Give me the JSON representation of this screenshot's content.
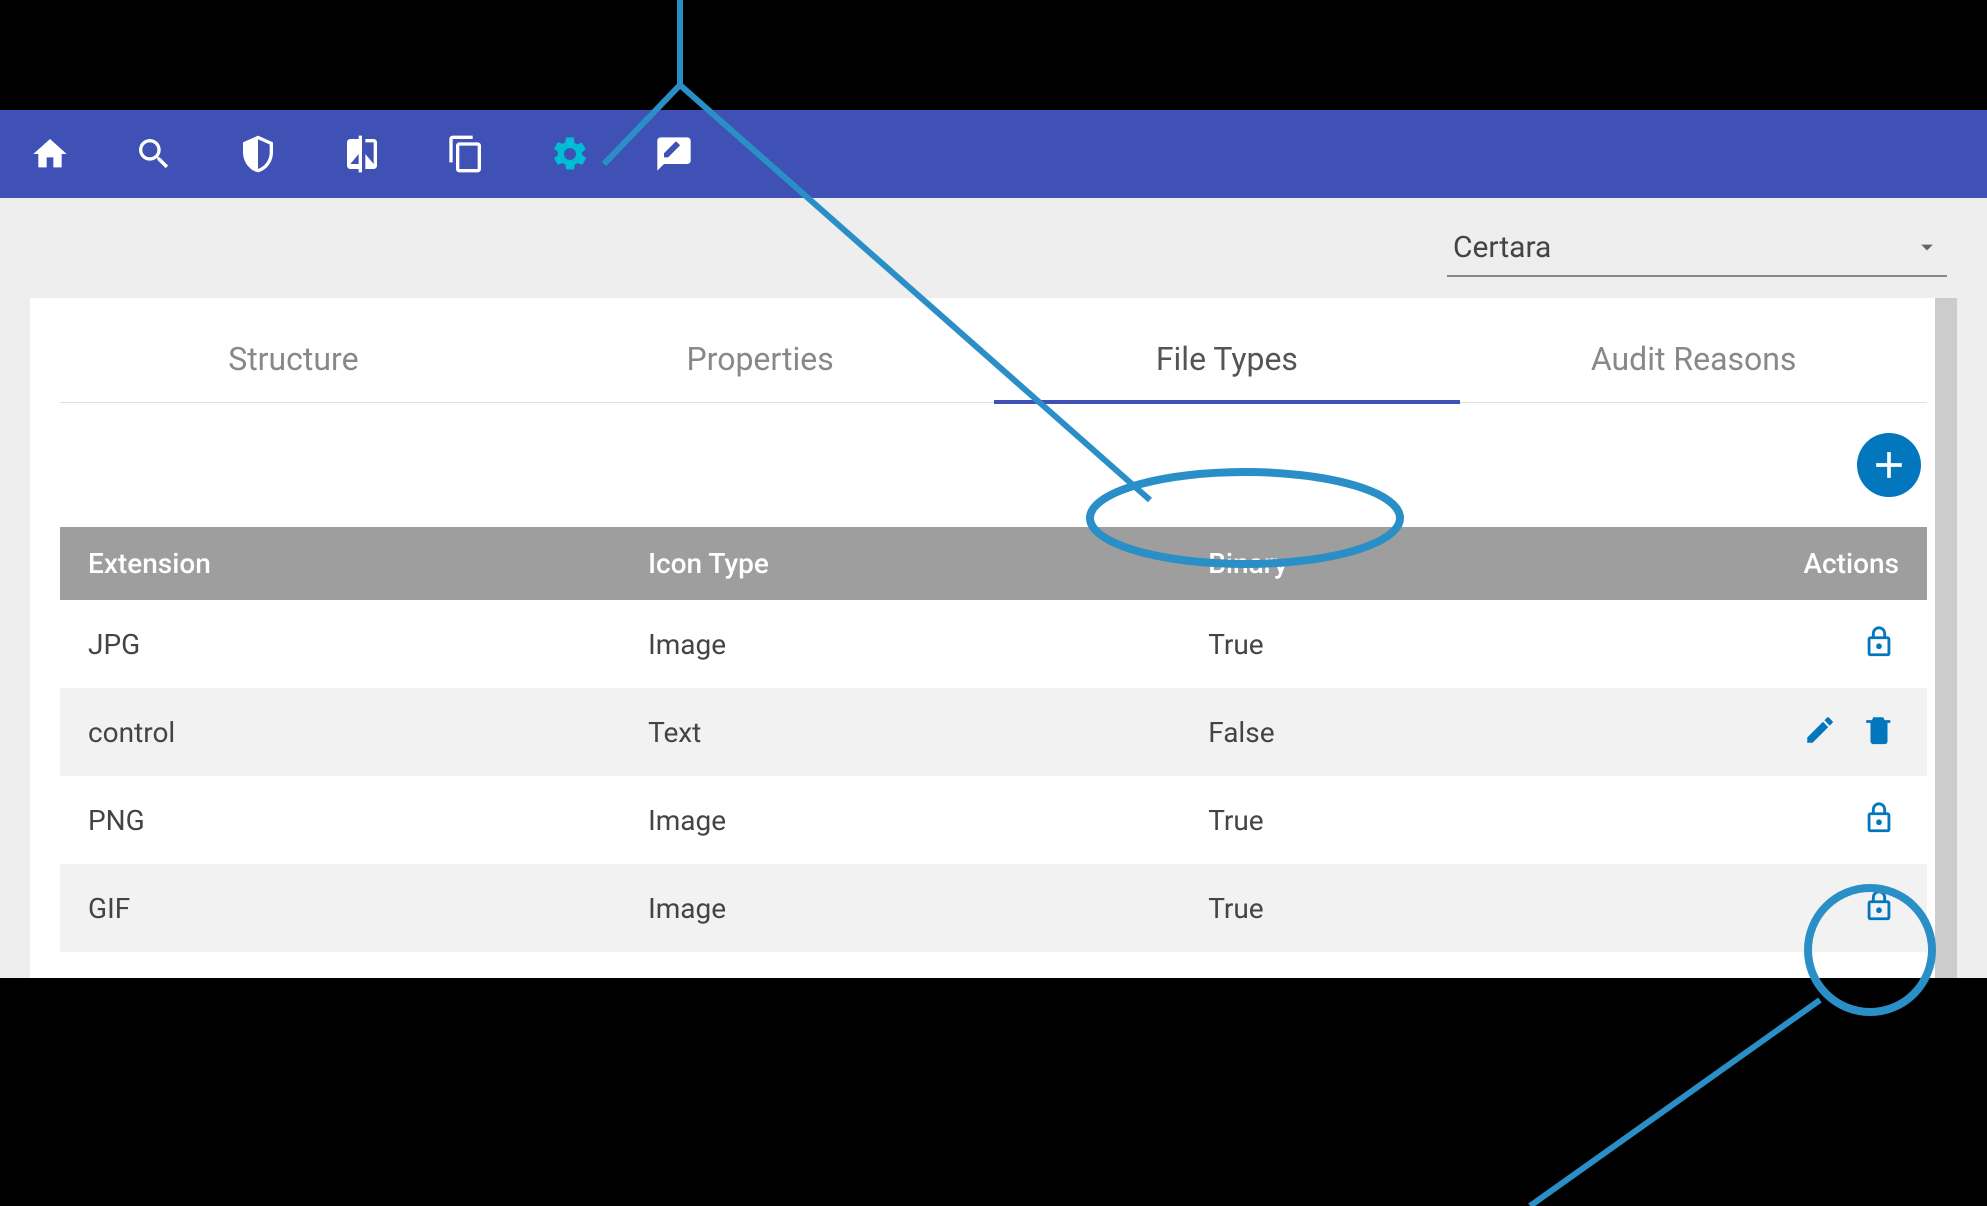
{
  "tenant": {
    "selected": "Certara"
  },
  "tabs": {
    "items": [
      {
        "label": "Structure",
        "active": false
      },
      {
        "label": "Properties",
        "active": false
      },
      {
        "label": "File Types",
        "active": true
      },
      {
        "label": "Audit Reasons",
        "active": false
      }
    ]
  },
  "table": {
    "columns": [
      "Extension",
      "Icon Type",
      "Binary",
      "Actions"
    ],
    "rows": [
      {
        "extension": "JPG",
        "iconType": "Image",
        "binary": "True",
        "actions": "lock"
      },
      {
        "extension": "control",
        "iconType": "Text",
        "binary": "False",
        "actions": "edit-delete"
      },
      {
        "extension": "PNG",
        "iconType": "Image",
        "binary": "True",
        "actions": "lock"
      },
      {
        "extension": "GIF",
        "iconType": "Image",
        "binary": "True",
        "actions": "lock"
      }
    ]
  },
  "colors": {
    "primary": "#3f51b5",
    "accent": "#00bcd4",
    "actionIcon": "#0277bd",
    "headerGrey": "#9e9e9e",
    "annotation": "#2a8fc7"
  }
}
